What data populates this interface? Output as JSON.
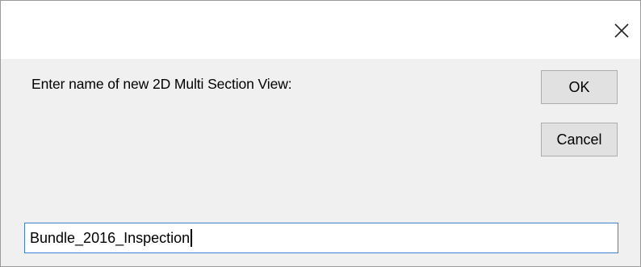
{
  "dialog": {
    "close_icon": "close-icon",
    "prompt": "Enter name of new 2D Multi Section View:",
    "ok_label": "OK",
    "cancel_label": "Cancel",
    "name_input": {
      "value": "Bundle_2016_Inspection"
    }
  },
  "colors": {
    "dialog_background": "#f0f0f0",
    "title_bar_background": "#ffffff",
    "button_background": "#e1e1e1",
    "button_border": "#adadad",
    "input_focus_border": "#3b82d6"
  }
}
